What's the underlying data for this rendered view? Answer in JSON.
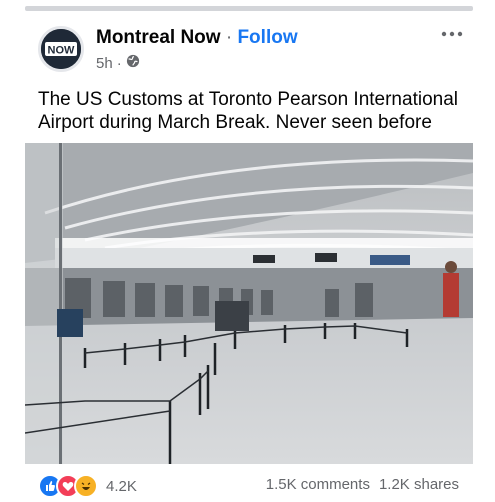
{
  "post": {
    "page_name": "Montreal Now",
    "separator": "·",
    "follow_label": "Follow",
    "time": "5h",
    "time_separator": "·",
    "visibility_icon": "globe-icon",
    "caption": "The US Customs at Toronto Pearson International Airport during March Break. Never seen before",
    "avatar_text": "NOW"
  },
  "footer": {
    "reaction_icons": [
      "like-icon",
      "love-icon",
      "haha-icon"
    ],
    "reaction_count": "4.2K",
    "comments": "1.5K comments",
    "shares": "1.2K shares"
  },
  "colors": {
    "accent": "#1877f2",
    "secondary_text": "#65676b",
    "like": "#1877f2",
    "love": "#f33e58",
    "haha": "#f7b125"
  }
}
